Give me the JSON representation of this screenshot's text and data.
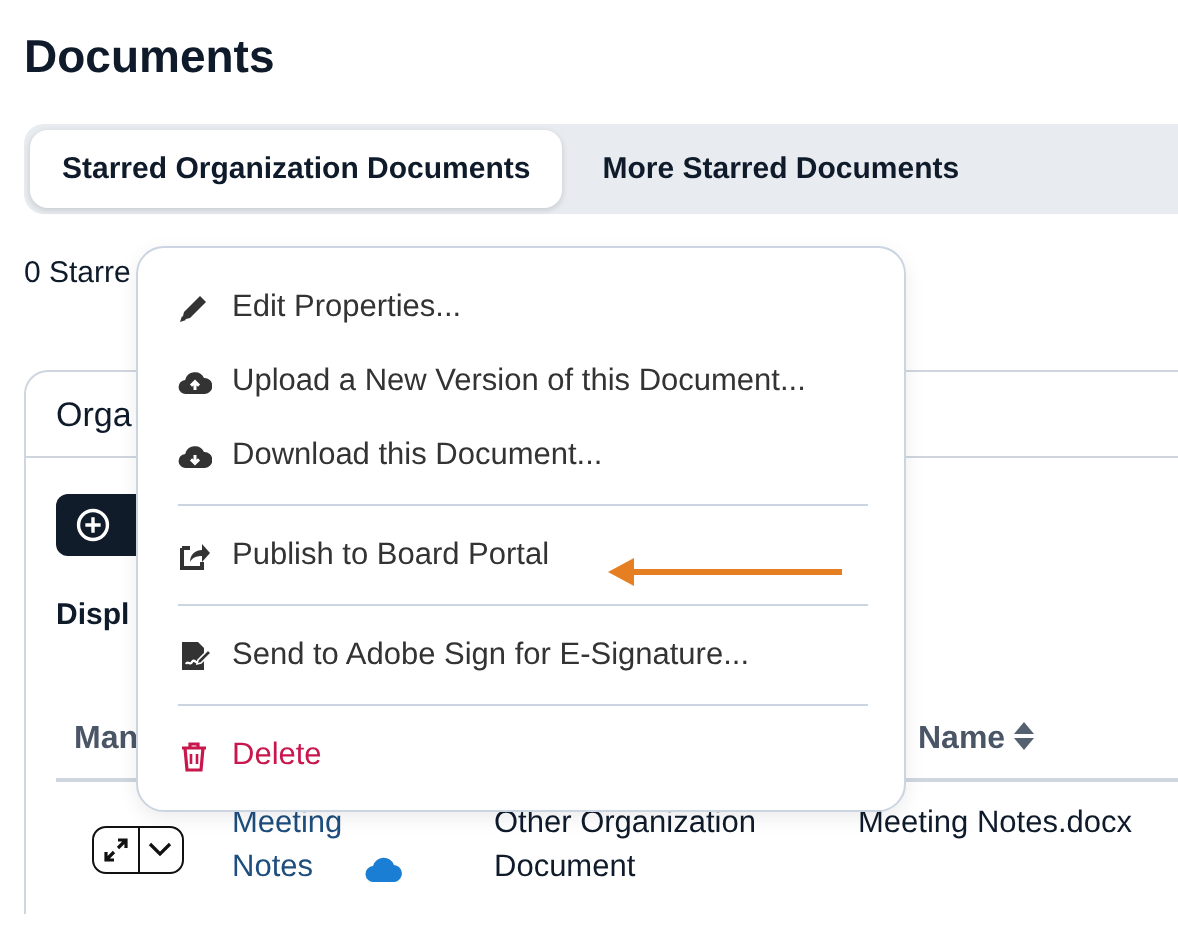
{
  "page_title": "Documents",
  "tabs": [
    {
      "label": "Starred Organization Documents",
      "selected": true
    },
    {
      "label": "More Starred Documents",
      "selected": false
    }
  ],
  "count_text": "0 Starre",
  "card": {
    "title": "Orga",
    "display_label": "Displ",
    "table": {
      "columns": [
        {
          "label": "Man"
        },
        {
          "label": "Name",
          "sortable": true
        }
      ],
      "rows": [
        {
          "title": "Meeting Notes",
          "type": "Other Organization Document",
          "file_name": "Meeting Notes.docx"
        }
      ]
    }
  },
  "context_menu": {
    "items": [
      {
        "kind": "edit",
        "label": "Edit Properties..."
      },
      {
        "kind": "upload",
        "label": "Upload a New Version of this Document..."
      },
      {
        "kind": "download",
        "label": "Download this Document..."
      },
      {
        "kind": "divider"
      },
      {
        "kind": "publish",
        "label": "Publish to Board Portal"
      },
      {
        "kind": "divider"
      },
      {
        "kind": "sign",
        "label": "Send to Adobe Sign for E-Signature..."
      },
      {
        "kind": "divider"
      },
      {
        "kind": "delete",
        "label": "Delete"
      }
    ]
  }
}
